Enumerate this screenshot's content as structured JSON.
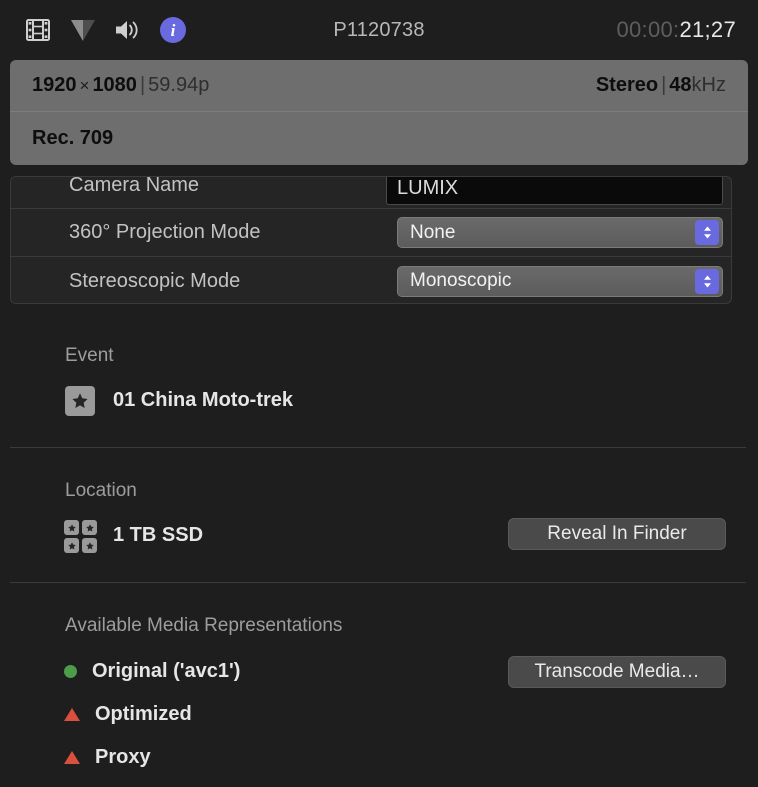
{
  "toolbar": {
    "icons": [
      {
        "name": "film-strip-icon",
        "label": "Video"
      },
      {
        "name": "filter-triangle-icon",
        "label": "Effects"
      },
      {
        "name": "speaker-icon",
        "label": "Audio"
      },
      {
        "name": "info-badge-icon",
        "label": "Info"
      }
    ],
    "clip_name": "P1120738",
    "timecode_dim": "00:00:",
    "timecode_main": "21;27",
    "info_badge_color": "#6a6ae0"
  },
  "info_banner": {
    "width": "1920",
    "times_symbol": "×",
    "height": "1080",
    "separator": "|",
    "frame_rate": "59.94p",
    "audio_channels": "Stereo",
    "audio_rate_num": "48",
    "audio_rate_unit": "kHz",
    "color_space": "Rec. 709",
    "background": "#6e6e6e"
  },
  "form": {
    "rows": [
      {
        "label": "Camera Name",
        "control": "text-field",
        "value": "LUMIX"
      },
      {
        "label": "360° Projection Mode",
        "control": "popup",
        "value": "None"
      },
      {
        "label": "Stereoscopic Mode",
        "control": "popup",
        "value": "Monoscopic"
      }
    ]
  },
  "event_section": {
    "title": "Event",
    "icon": "event-star-icon",
    "name": "01 China Moto-trek"
  },
  "location_section": {
    "title": "Location",
    "icon": "library-grid-icon",
    "name": "1 TB SSD",
    "button_label": "Reveal In Finder"
  },
  "media_section": {
    "title": "Available Media Representations",
    "button_label": "Transcode Media…",
    "items": [
      {
        "label": "Original ('avc1')",
        "status": "available",
        "status_color": "#4d9c4a"
      },
      {
        "label": "Optimized",
        "status": "missing",
        "status_color": "#d9503f"
      },
      {
        "label": "Proxy",
        "status": "missing",
        "status_color": "#d9503f"
      }
    ]
  }
}
